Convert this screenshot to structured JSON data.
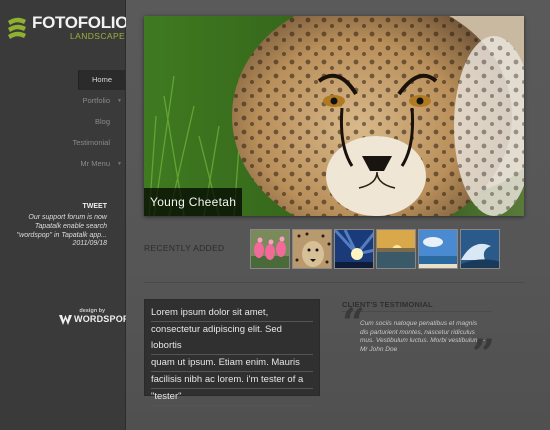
{
  "brand": {
    "title": "FOTOFOLIO",
    "subtitle": "LANDSCAPE",
    "accent_color": "#8fb131",
    "icon": "logo-mark-icon"
  },
  "nav": {
    "items": [
      {
        "label": "Home",
        "active": true,
        "has_submenu": false
      },
      {
        "label": "Portfolio",
        "active": false,
        "has_submenu": true
      },
      {
        "label": "Blog",
        "active": false,
        "has_submenu": false
      },
      {
        "label": "Testimonial",
        "active": false,
        "has_submenu": false
      },
      {
        "label": "Mr Menu",
        "active": false,
        "has_submenu": true
      }
    ],
    "submenu_caret": "▼"
  },
  "tweet": {
    "heading": "TWEET",
    "text": "Our support forum is now Tapatalk enable search \"wordspop\" in Tapatalk app...",
    "date": "2011/09/18"
  },
  "credit": {
    "label": "design by",
    "brand": "WORDSPOP"
  },
  "hero": {
    "caption": "Young Cheetah"
  },
  "recent": {
    "heading": "RECENTLY ADDED",
    "thumbnails": [
      {
        "subject": "flamingos"
      },
      {
        "subject": "cheetah"
      },
      {
        "subject": "sunburst-sky"
      },
      {
        "subject": "sunset-sea"
      },
      {
        "subject": "beach-sky"
      },
      {
        "subject": "wave"
      }
    ]
  },
  "intro": {
    "lines": [
      "Lorem ipsum dolor sit amet,",
      "consectetur adipiscing elit. Sed lobortis",
      "quam ut ipsum. Etiam enim. Mauris",
      "facilisis nibh ac lorem. i'm tester of a",
      "\"tester\""
    ]
  },
  "testimonial": {
    "heading": "CLIENT'S TESTIMONIAL",
    "text": "Cum sociis natoque penatibus et magnis dis parturient montes, nascetur ridiculus mus. Vestibulum luctus. Morbi vestibulum. - Mr John Doe",
    "open_quote": "“",
    "close_quote": "”"
  }
}
